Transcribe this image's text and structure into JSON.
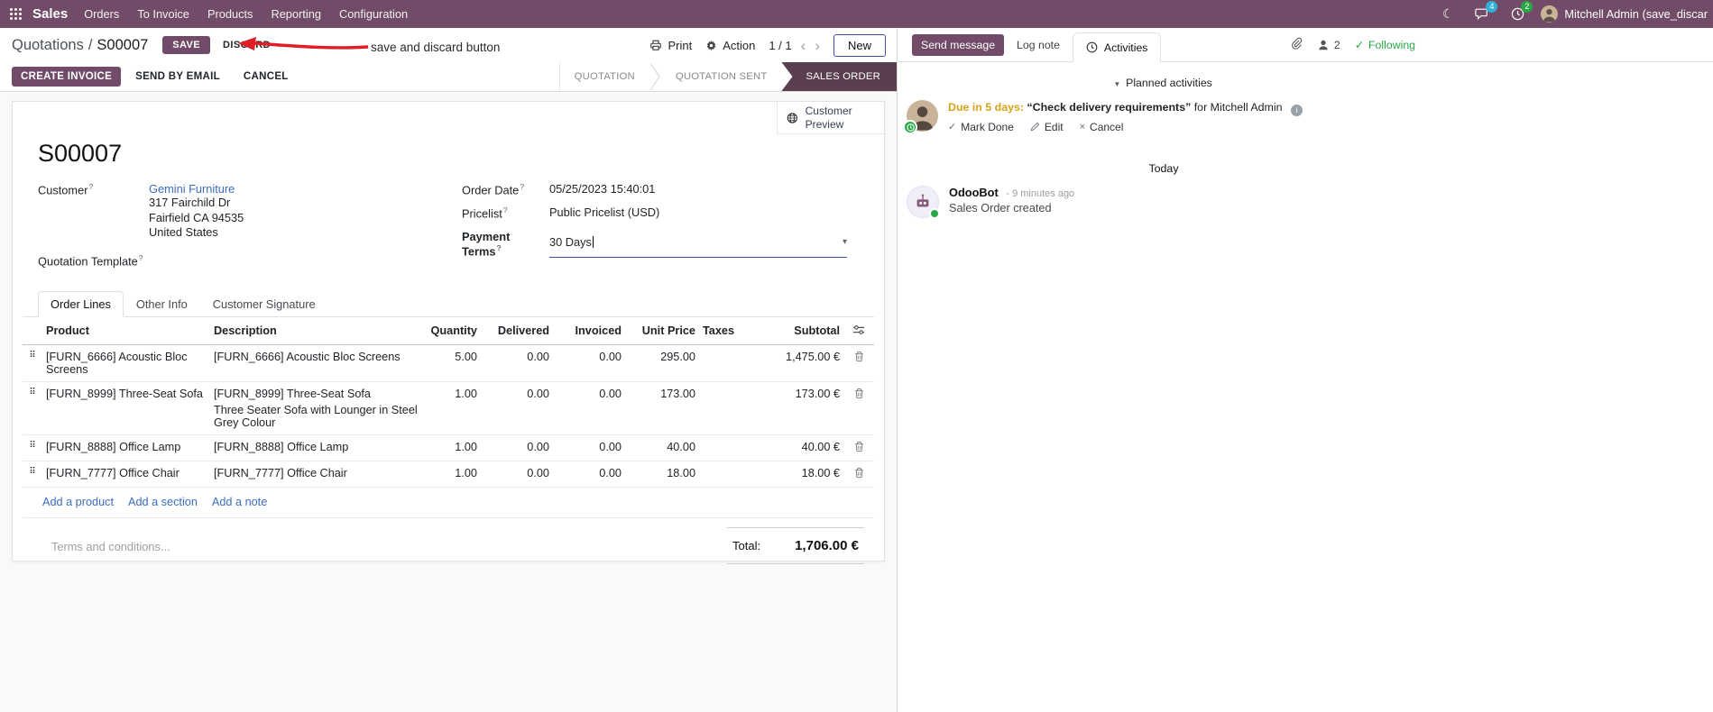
{
  "navbar": {
    "app_name": "Sales",
    "menus": [
      "Orders",
      "To Invoice",
      "Products",
      "Reporting",
      "Configuration"
    ],
    "messages_badge": "4",
    "activities_badge": "2",
    "user_name": "Mitchell Admin (save_discar"
  },
  "breadcrumb": {
    "parent": "Quotations",
    "separator": "/",
    "current": "S00007",
    "save": "SAVE",
    "discard": "DISCARD",
    "print": "Print",
    "action": "Action",
    "pager": "1 / 1",
    "new": "New"
  },
  "annotation": {
    "text": "save and discard button"
  },
  "statusbar": {
    "create_invoice": "CREATE INVOICE",
    "send_by_email": "SEND BY EMAIL",
    "cancel": "CANCEL",
    "steps": [
      "QUOTATION",
      "QUOTATION SENT",
      "SALES ORDER"
    ],
    "active_step": "SALES ORDER"
  },
  "sheet": {
    "preview_label": "Customer Preview",
    "title": "S00007",
    "customer": {
      "label": "Customer",
      "name": "Gemini Furniture",
      "address": [
        "317 Fairchild Dr",
        "Fairfield CA 94535",
        "United States"
      ]
    },
    "quotation_template": {
      "label": "Quotation Template"
    },
    "order_date": {
      "label": "Order Date",
      "value": "05/25/2023 15:40:01"
    },
    "pricelist": {
      "label": "Pricelist",
      "value": "Public Pricelist (USD)"
    },
    "payment_terms": {
      "label": "Payment Terms",
      "value": "30 Days"
    },
    "tabs": [
      "Order Lines",
      "Other Info",
      "Customer Signature"
    ],
    "active_tab": "Order Lines"
  },
  "order_lines": {
    "columns": [
      "Product",
      "Description",
      "Quantity",
      "Delivered",
      "Invoiced",
      "Unit Price",
      "Taxes",
      "Subtotal"
    ],
    "rows": [
      {
        "product": "[FURN_6666] Acoustic Bloc Screens",
        "description": "[FURN_6666] Acoustic Bloc Screens",
        "description2": "",
        "quantity": "5.00",
        "delivered": "0.00",
        "invoiced": "0.00",
        "unit_price": "295.00",
        "taxes": "",
        "subtotal": "1,475.00 €"
      },
      {
        "product": "[FURN_8999] Three-Seat Sofa",
        "description": "[FURN_8999] Three-Seat Sofa",
        "description2": "Three Seater Sofa with Lounger in Steel Grey Colour",
        "quantity": "1.00",
        "delivered": "0.00",
        "invoiced": "0.00",
        "unit_price": "173.00",
        "taxes": "",
        "subtotal": "173.00 €"
      },
      {
        "product": "[FURN_8888] Office Lamp",
        "description": "[FURN_8888] Office Lamp",
        "description2": "",
        "quantity": "1.00",
        "delivered": "0.00",
        "invoiced": "0.00",
        "unit_price": "40.00",
        "taxes": "",
        "subtotal": "40.00 €"
      },
      {
        "product": "[FURN_7777] Office Chair",
        "description": "[FURN_7777] Office Chair",
        "description2": "",
        "quantity": "1.00",
        "delivered": "0.00",
        "invoiced": "0.00",
        "unit_price": "18.00",
        "taxes": "",
        "subtotal": "18.00 €"
      }
    ],
    "add_product": "Add a product",
    "add_section": "Add a section",
    "add_note": "Add a note",
    "terms_placeholder": "Terms and conditions...",
    "total_label": "Total:",
    "total_value": "1,706.00 €"
  },
  "chatter": {
    "send_message": "Send message",
    "log_note": "Log note",
    "activities": "Activities",
    "followers_count": "2",
    "following": "Following",
    "planned_header": "Planned activities",
    "activity": {
      "due": "Due in 5 days:",
      "summary": "“Check delivery requirements”",
      "for_text": "for Mitchell Admin",
      "mark_done": "Mark Done",
      "edit": "Edit",
      "cancel": "Cancel"
    },
    "today": "Today",
    "message": {
      "author": "OdooBot",
      "time": "- 9 minutes ago",
      "body": "Sales Order created"
    }
  },
  "icons": {
    "drag": "⠿",
    "moon": "☾",
    "caret_down": "▾",
    "check": "✓",
    "close": "×",
    "prev": "‹",
    "next": "›",
    "help": "?"
  },
  "colors": {
    "brand": "#714B67",
    "active_step": "#5a3f51",
    "link": "#3d6dbd",
    "success": "#28a745",
    "due_warning": "#d9a119",
    "annotation_red": "#e11d26"
  }
}
